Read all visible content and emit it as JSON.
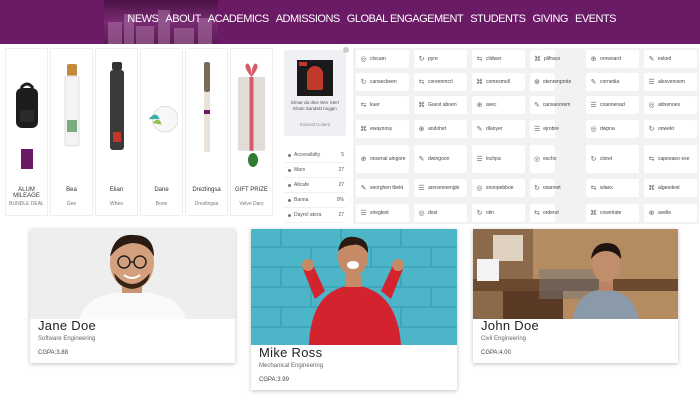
{
  "header": {
    "nav": [
      "NEWS",
      "ABOUT",
      "ACADEMICS",
      "ADMISSIONS",
      "GLOBAL ENGAGEMENT",
      "STUDENTS",
      "GIVING",
      "EVENTS"
    ],
    "brand_color": "#6b1a66"
  },
  "products": [
    {
      "name": "ALUM MILEAGE",
      "price": "BUNDLE DEAL",
      "icon": "backpack-icon"
    },
    {
      "name": "Bea",
      "price": "Gee",
      "icon": "tumbler-icon"
    },
    {
      "name": "Elian",
      "price": "Wheo",
      "icon": "bottle-icon"
    },
    {
      "name": "Dane",
      "price": "Bone",
      "icon": "disc-icon"
    },
    {
      "name": "Drezlingsa",
      "price": "Drezlingsa",
      "icon": "pen-icon"
    },
    {
      "name": "GIFT PRIZE",
      "price": "Velve Dary",
      "icon": "gift-icon"
    }
  ],
  "podcast": {
    "title": "Elmar da dine Wer Sterl Elsan Sandskt hoggin",
    "subtitle": "Eoloval Coilent"
  },
  "categories": [
    {
      "label": "Accessibilty",
      "count": "5"
    },
    {
      "label": "Mars",
      "count": "27"
    },
    {
      "label": "Allcafe",
      "count": "27"
    },
    {
      "label": "Banna",
      "count": "0%"
    },
    {
      "label": "Dayrol atera",
      "count": "27"
    }
  ],
  "grid": [
    [
      "clocam",
      "pyre",
      "clidwer",
      "plifrace",
      "orowoard",
      "esked"
    ],
    [
      "canseckeen",
      "coreenmcrl",
      "comesmoll",
      "otenrenprote",
      "cornedia",
      "alexvenoem"
    ],
    [
      "kuer",
      "Guest aboen",
      "avec",
      "cansaoorem",
      "cnaonenad",
      "adnenoes"
    ],
    [
      "ewaynosy",
      "andohet",
      "dlanyer",
      "ejrobre",
      "dwpna",
      "onwekt"
    ],
    [
      "onsenal alngore",
      "dwingoon",
      "lochpa",
      "escho",
      "cloret",
      "capeeaeo exe"
    ],
    [
      "seorghen tbekt",
      "annsennengle",
      "snoopebboe",
      "osannet",
      "wlaex",
      "algeedest"
    ],
    [
      "srlegkiot",
      "dost",
      "olin",
      "orderut",
      "cowelrate",
      "avelle"
    ]
  ],
  "people": [
    {
      "name": "Jane Doe",
      "major": "Software Engineering",
      "gpa": "CGPA:3.88"
    },
    {
      "name": "Mike Ross",
      "major": "Mechanical Engineering",
      "gpa": "CGPA:3.99"
    },
    {
      "name": "John Doe",
      "major": "Civil Engineering",
      "gpa": "CGPA:4.00"
    }
  ]
}
